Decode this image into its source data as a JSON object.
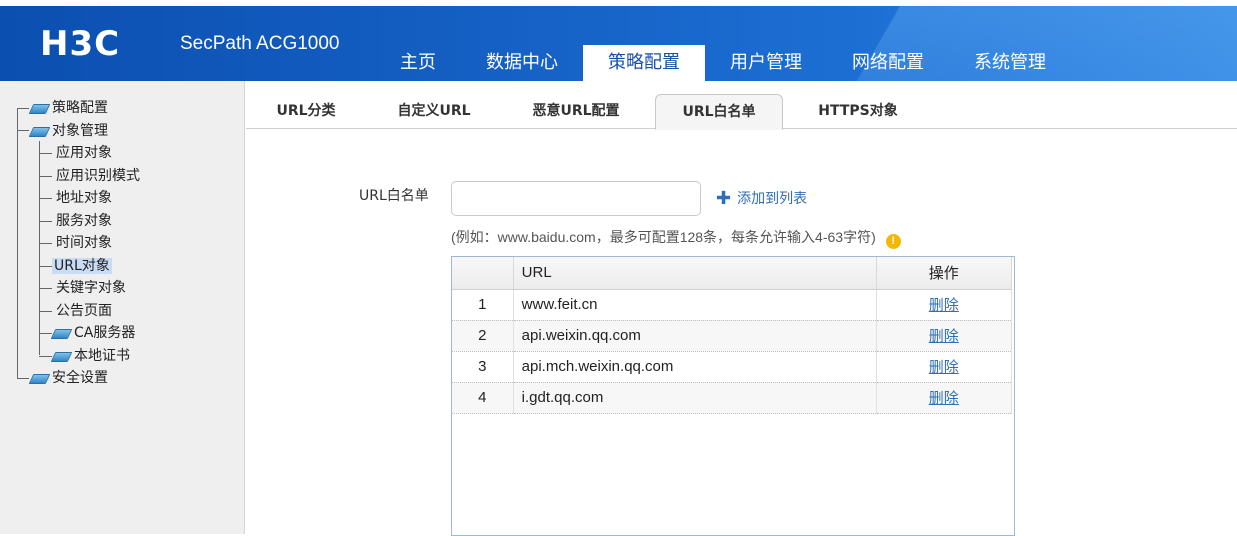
{
  "header": {
    "logo": "H3C",
    "product": "SecPath ACG1000",
    "nav": [
      "主页",
      "数据中心",
      "策略配置",
      "用户管理",
      "网络配置",
      "系统管理"
    ],
    "active_nav": "策略配置"
  },
  "sidebar": {
    "items": [
      {
        "label": "策略配置",
        "level": 0,
        "icon": "folder-icon"
      },
      {
        "label": "对象管理",
        "level": 0,
        "icon": "folder-icon"
      },
      {
        "label": "应用对象",
        "level": 1
      },
      {
        "label": "应用识别模式",
        "level": 1
      },
      {
        "label": "地址对象",
        "level": 1
      },
      {
        "label": "服务对象",
        "level": 1
      },
      {
        "label": "时间对象",
        "level": 1
      },
      {
        "label": "URL对象",
        "level": 1,
        "selected": true
      },
      {
        "label": "关键字对象",
        "level": 1
      },
      {
        "label": "公告页面",
        "level": 1
      },
      {
        "label": "CA服务器",
        "level": 1,
        "icon": "folder-icon"
      },
      {
        "label": "本地证书",
        "level": 1,
        "icon": "folder-icon"
      },
      {
        "label": "安全设置",
        "level": 0,
        "icon": "folder-icon"
      }
    ]
  },
  "tabs": [
    "URL分类",
    "自定义URL",
    "恶意URL配置",
    "URL白名单",
    "HTTPS对象"
  ],
  "active_tab": "URL白名单",
  "form": {
    "label": "URL白名单",
    "input_value": "",
    "add_label": "添加到列表",
    "hint": "(例如：www.baidu.com，最多可配置128条，每条允许输入4-63字符)"
  },
  "table": {
    "headers": [
      "",
      "URL",
      "操作"
    ],
    "rows": [
      {
        "idx": "1",
        "url": "www.feit.cn",
        "action": "删除"
      },
      {
        "idx": "2",
        "url": "api.weixin.qq.com",
        "action": "删除"
      },
      {
        "idx": "3",
        "url": "api.mch.weixin.qq.com",
        "action": "删除"
      },
      {
        "idx": "4",
        "url": "i.gdt.qq.com",
        "action": "删除"
      }
    ]
  },
  "colors": {
    "header_blue": "#1560c4",
    "link_blue": "#2f6fb5",
    "warning": "#f5b800"
  }
}
